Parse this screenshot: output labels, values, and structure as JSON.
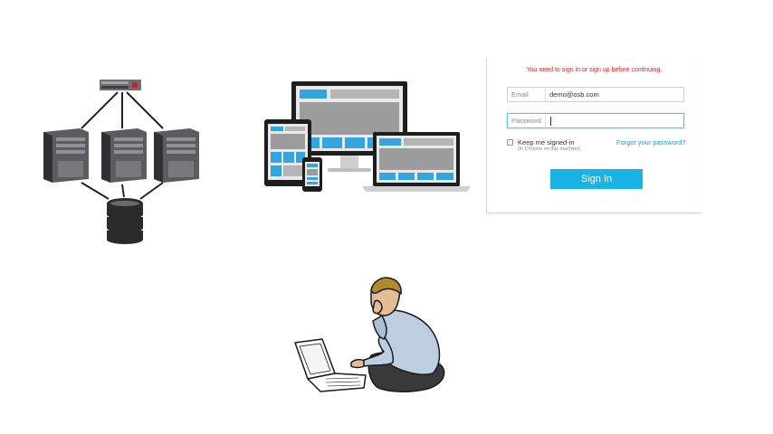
{
  "login": {
    "error_message": "You need to sign in or sign up before continuing.",
    "email_label": "Email",
    "email_value": "demo@osb.com",
    "password_label": "Password",
    "password_value": "",
    "remember_label": "Keep me signed-in",
    "remember_note": "(in Chrome on this machine)",
    "forgot_link": "Forgot your password?",
    "signin_button": "Sign In"
  },
  "colors": {
    "accent": "#19b3e6",
    "error": "#e0201a",
    "link": "#1a9ad6"
  },
  "illustrations": {
    "network": "server-network-icon",
    "devices": "responsive-devices-icon",
    "person": "person-with-laptop-icon"
  }
}
